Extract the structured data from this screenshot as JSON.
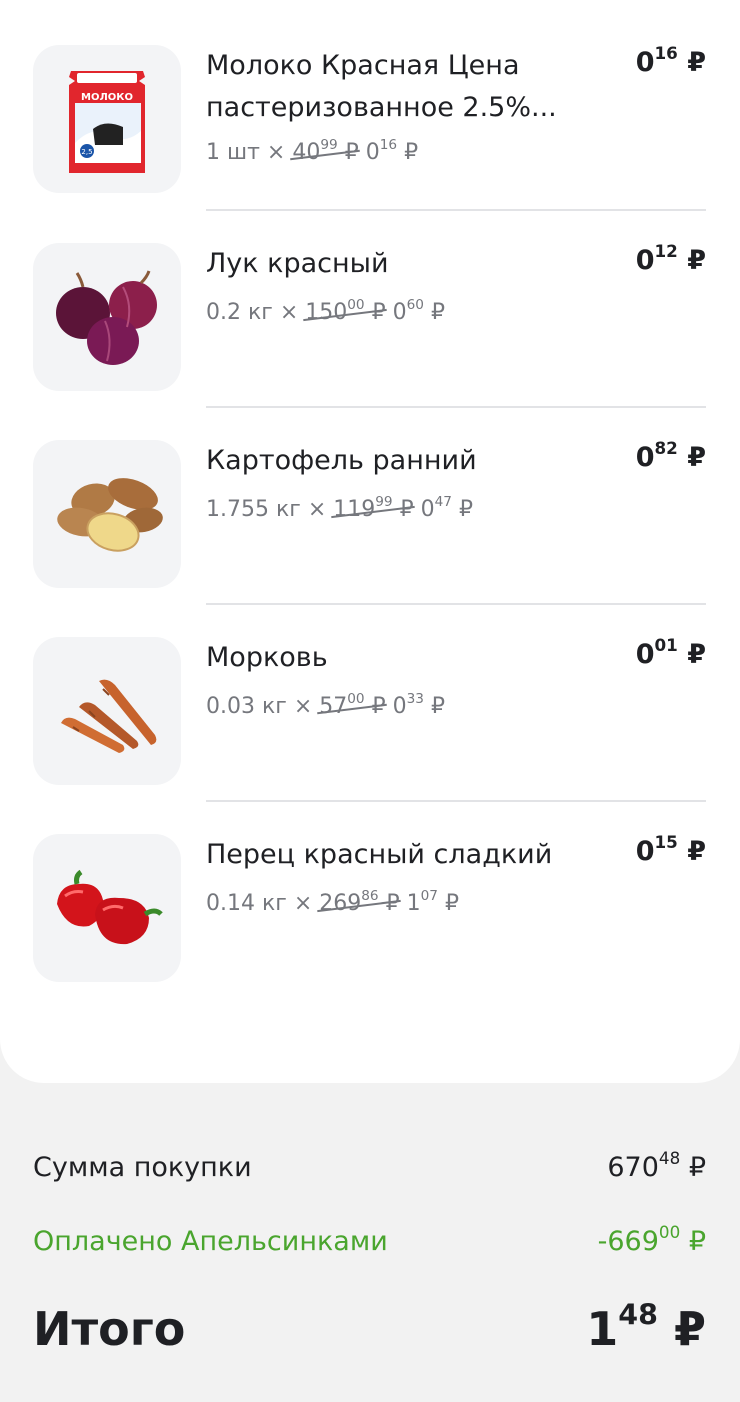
{
  "items": [
    {
      "name": "Молоко Красная Цена пастеризованное 2.5%...",
      "qty": "1 шт ×",
      "old_int": "40",
      "old_frac": "99",
      "new_int": "0",
      "new_frac": "16",
      "total_int": "0",
      "total_frac": "16",
      "icon": "milk-pack-icon",
      "pack_label": "МОЛОКО",
      "pack_fat": "2,5"
    },
    {
      "name": "Лук красный",
      "qty": "0.2 кг ×",
      "old_int": "150",
      "old_frac": "00",
      "new_int": "0",
      "new_frac": "60",
      "total_int": "0",
      "total_frac": "12",
      "icon": "red-onion-icon"
    },
    {
      "name": "Картофель ранний",
      "qty": "1.755 кг ×",
      "old_int": "119",
      "old_frac": "99",
      "new_int": "0",
      "new_frac": "47",
      "total_int": "0",
      "total_frac": "82",
      "icon": "potato-icon"
    },
    {
      "name": "Морковь",
      "qty": "0.03 кг ×",
      "old_int": "57",
      "old_frac": "00",
      "new_int": "0",
      "new_frac": "33",
      "total_int": "0",
      "total_frac": "01",
      "icon": "carrot-icon"
    },
    {
      "name": "Перец красный сладкий",
      "qty": "0.14 кг ×",
      "old_int": "269",
      "old_frac": "86",
      "new_int": "1",
      "new_frac": "07",
      "total_int": "0",
      "total_frac": "15",
      "icon": "red-pepper-icon"
    }
  ],
  "currency": "₽",
  "summary": {
    "purchase_label": "Сумма покупки",
    "purchase_int": "670",
    "purchase_frac": "48",
    "paid_label": "Оплачено Апельсинками",
    "paid_int": "-669",
    "paid_frac": "00",
    "total_label": "Итого",
    "total_int": "1",
    "total_frac": "48"
  },
  "colors": {
    "accent_green": "#4aa52e",
    "text_primary": "#1f2024",
    "text_secondary": "#75777d",
    "background": "#f2f2f2"
  }
}
